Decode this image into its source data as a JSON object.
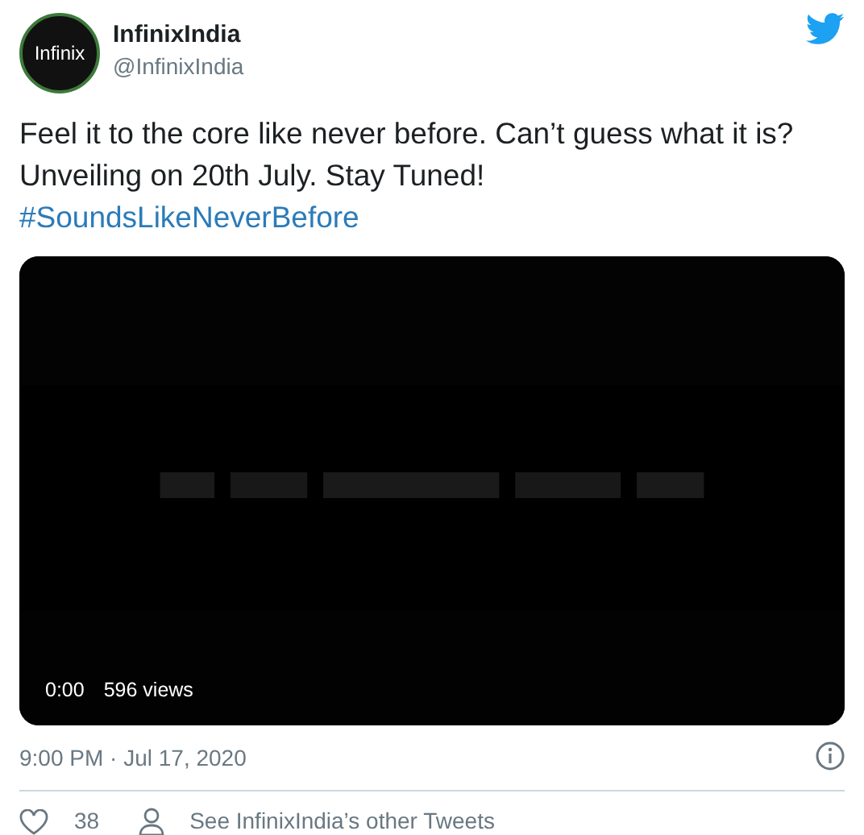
{
  "author": {
    "avatar_text": "Infinix",
    "name": "InfinixIndia",
    "handle": "@InfinixIndia"
  },
  "tweet": {
    "text": "Feel it to the core like never before. Can’t guess what it is? Unveiling on 20th July. Stay Tuned!",
    "hashtag": "#SoundsLikeNeverBefore"
  },
  "video": {
    "kind": "picture",
    "time": "0:00",
    "views": "596 views"
  },
  "timestamp": "9:00 PM · Jul 17, 2020",
  "actions": {
    "likes": "38",
    "other_tweets": "See InfinixIndia’s other Tweets"
  }
}
